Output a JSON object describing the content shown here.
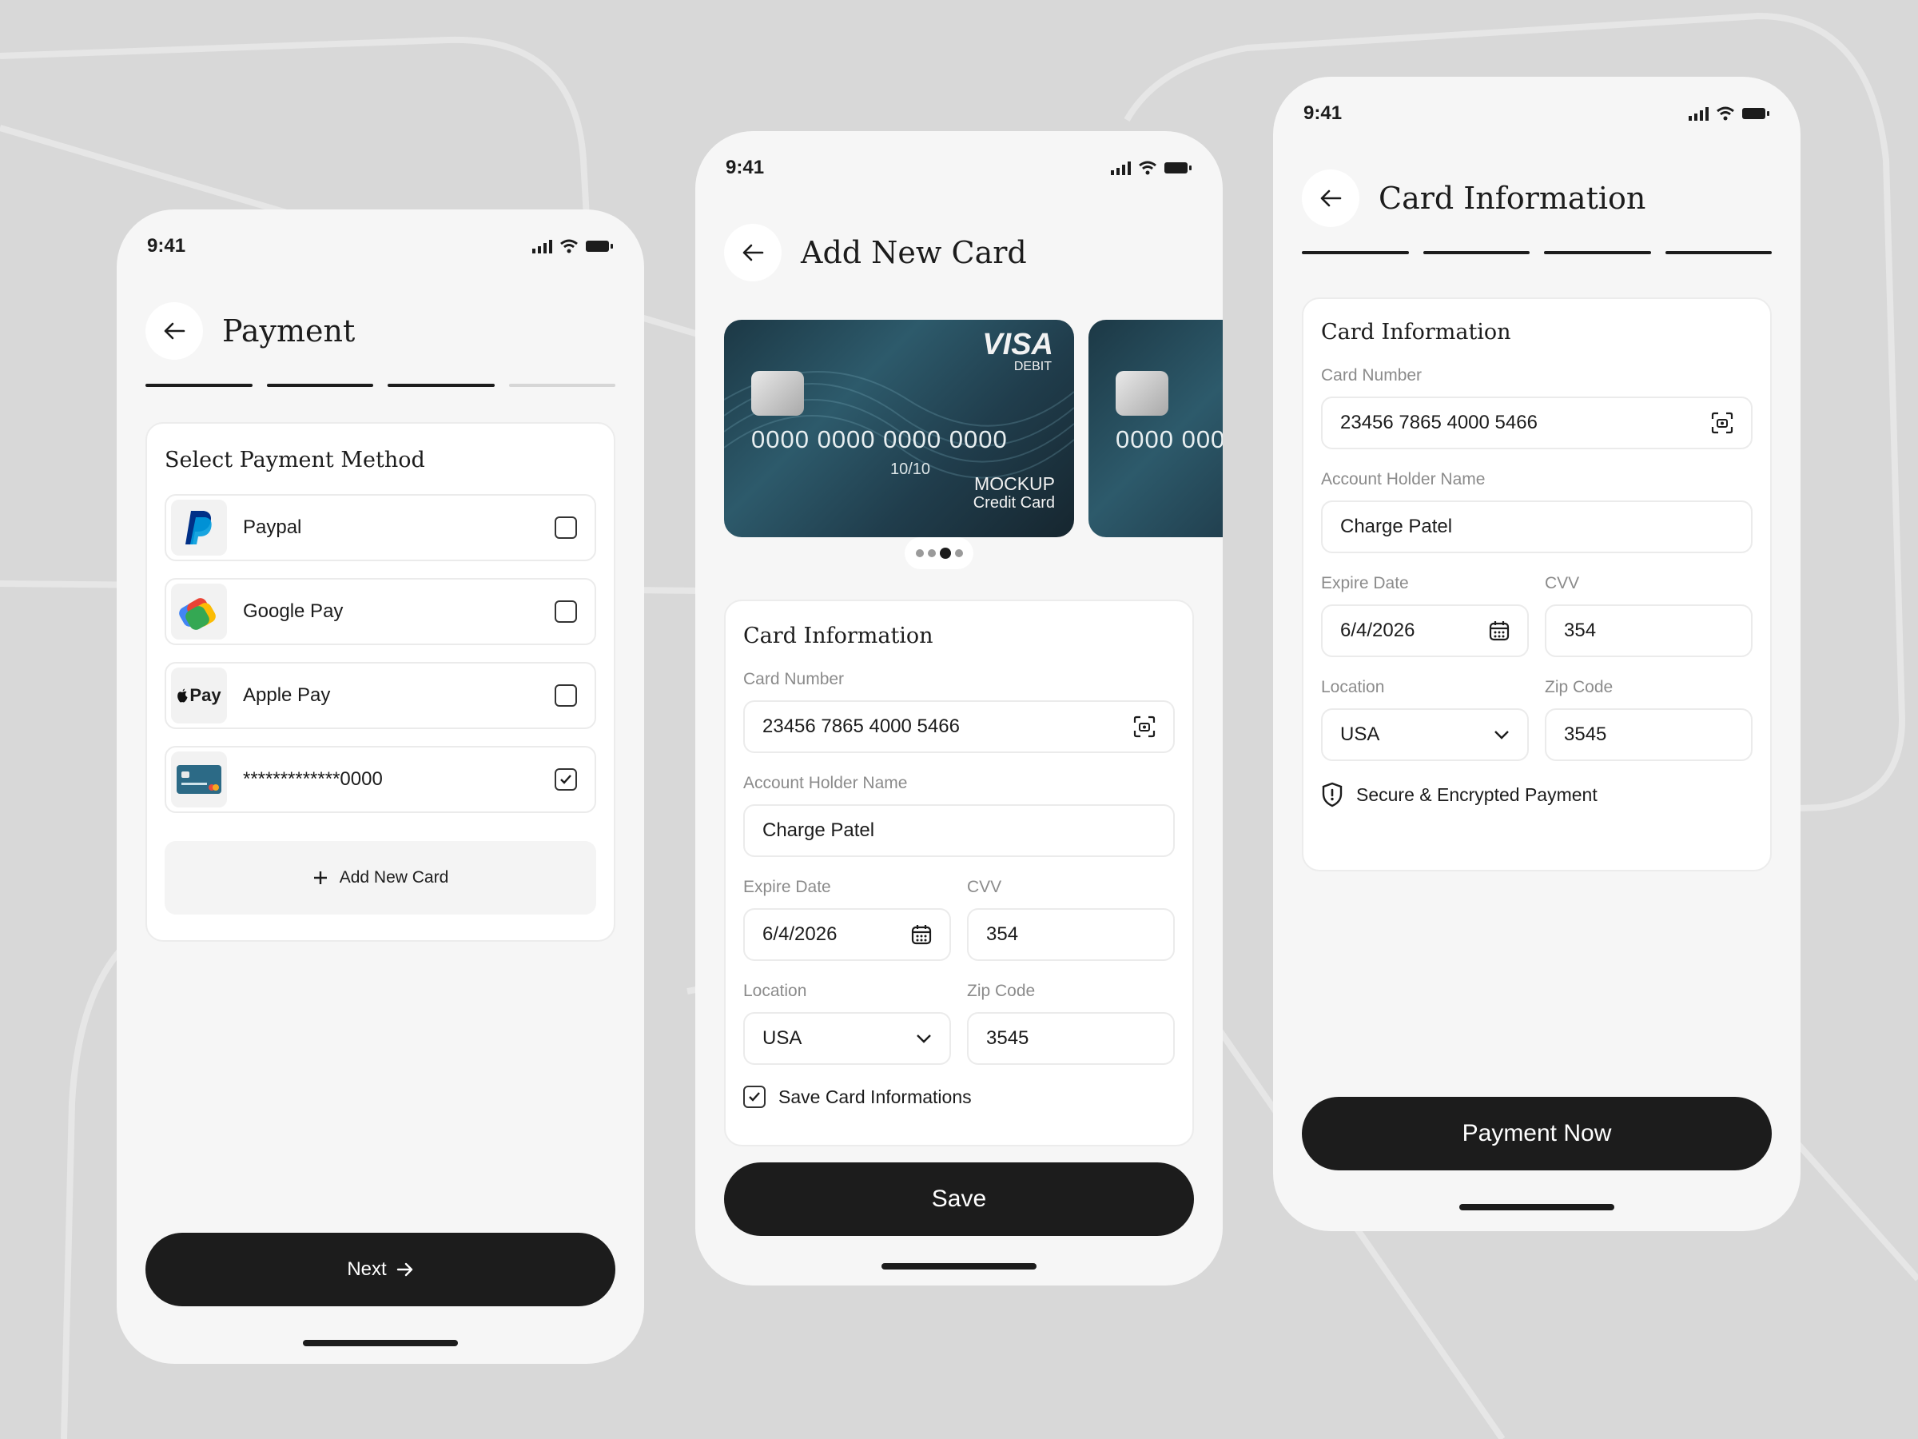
{
  "status": {
    "time": "9:41"
  },
  "screen1": {
    "title": "Payment",
    "section_title": "Select Payment Method",
    "methods": [
      {
        "name": "Paypal",
        "icon": "paypal-logo",
        "checked": false
      },
      {
        "name": "Google Pay",
        "icon": "google-pay-logo",
        "checked": false
      },
      {
        "name": "Apple Pay",
        "icon": "apple-pay-logo",
        "logo_text": "Pay",
        "checked": false
      },
      {
        "name": "*************0000",
        "icon": "card-thumbnail",
        "checked": true
      }
    ],
    "add_card": "Add New Card",
    "next": "Next"
  },
  "screen2": {
    "title": "Add New Card",
    "card": {
      "brand": "VISA",
      "type": "DEBIT",
      "number": "0000  0000  0000  0000",
      "number_partial": "0000  000",
      "expiry": "10/10",
      "mockup_line1": "MOCKUP",
      "mockup_line2": "Credit Card"
    },
    "form_title": "Card Information",
    "card_number_label": "Card Number",
    "card_number": "23456 7865 4000 5466",
    "holder_label": "Account Holder Name",
    "holder": "Charge Patel",
    "expire_label": "Expire Date",
    "expire": "6/4/2026",
    "cvv_label": "CVV",
    "cvv": "354",
    "location_label": "Location",
    "location": "USA",
    "zip_label": "Zip Code",
    "zip": "3545",
    "save_info": "Save Card Informations",
    "save": "Save"
  },
  "screen3": {
    "title": "Card Information",
    "form_title": "Card Information",
    "card_number_label": "Card Number",
    "card_number": "23456 7865 4000 5466",
    "holder_label": "Account Holder Name",
    "holder": "Charge Patel",
    "expire_label": "Expire Date",
    "expire": "6/4/2026",
    "cvv_label": "CVV",
    "cvv": "354",
    "location_label": "Location",
    "location": "USA",
    "zip_label": "Zip Code",
    "zip": "3545",
    "secure": "Secure & Encrypted Payment",
    "pay": "Payment Now"
  },
  "colors": {
    "background": "#d8d8d8",
    "phone": "#f6f6f6",
    "accent": "#1c1c1c",
    "card": "#2d5a6b"
  }
}
